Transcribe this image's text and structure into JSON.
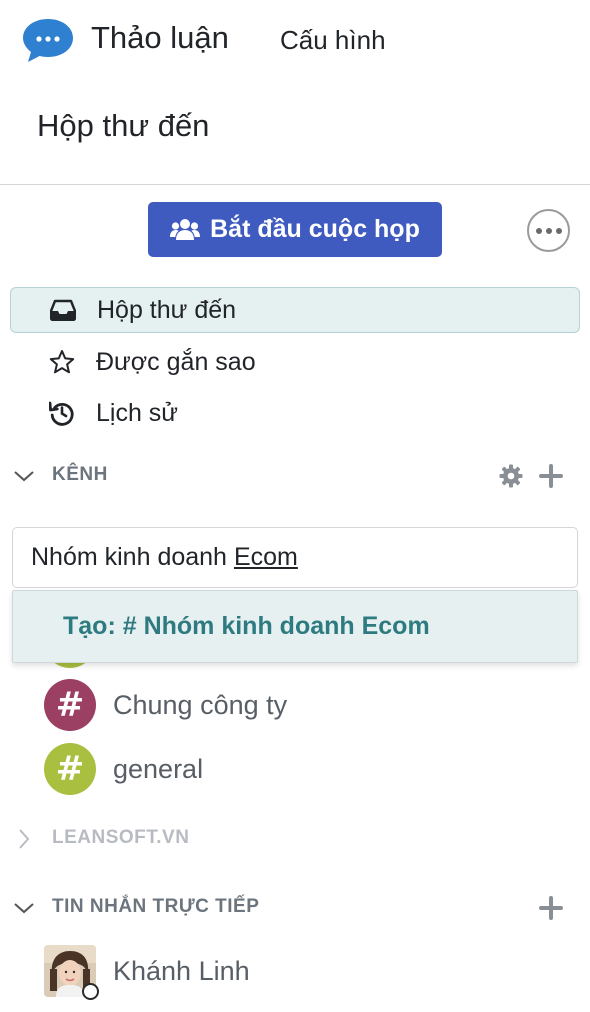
{
  "header": {
    "app_title": "Thảo luận",
    "config_link": "Cấu hình",
    "breadcrumb": "Hộp thư đến"
  },
  "actions": {
    "start_meeting": "Bắt đầu cuộc họp",
    "start_meeting_icon": "users-icon",
    "more_icon": "ellipsis-icon",
    "accent_color": "#3f5bbf"
  },
  "nav": {
    "items": [
      {
        "label": "Hộp thư đến",
        "icon": "inbox-icon",
        "active": true
      },
      {
        "label": "Được gắn sao",
        "icon": "star-icon",
        "active": false
      },
      {
        "label": "Lịch sử",
        "icon": "history-icon",
        "active": false
      }
    ]
  },
  "channels_section": {
    "title": "KÊNH",
    "settings_icon": "gear-icon",
    "add_icon": "plus-icon",
    "input_value_plain": "Nhóm kinh doanh",
    "input_value_underlined": "Ecom",
    "create_suggestion": "Tạo: # Nhóm kinh doanh Ecom",
    "items": [
      {
        "label": "Chung công ty",
        "avatar_symbol": "#",
        "color": "#9b3f63"
      },
      {
        "label": "general",
        "avatar_symbol": "#",
        "color": "#a8bf3f"
      }
    ]
  },
  "workspace_section": {
    "title": "LEANSOFT.VN",
    "collapsed": true
  },
  "dm_section": {
    "title": "TIN NHẮN TRỰC TIẾP",
    "add_icon": "plus-icon",
    "items": [
      {
        "label": "Khánh Linh",
        "status": "offline"
      }
    ]
  }
}
